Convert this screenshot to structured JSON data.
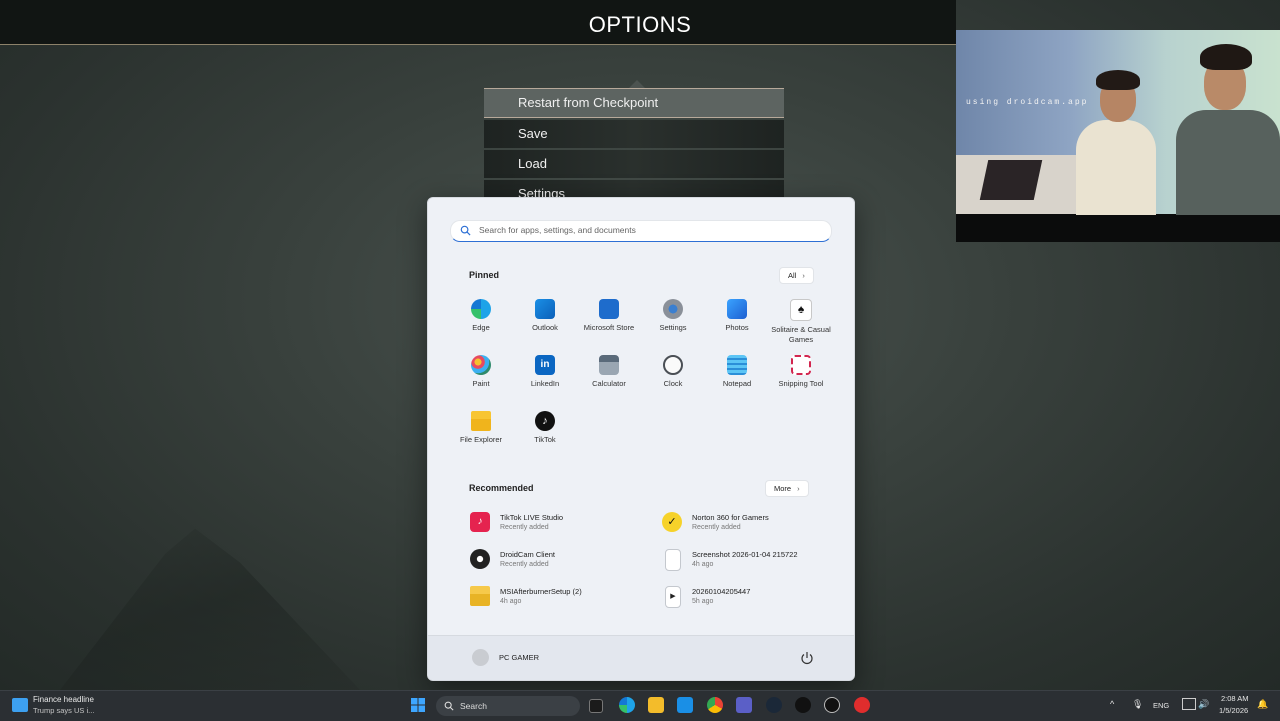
{
  "game": {
    "title": "OPTIONS",
    "menu": [
      "Restart from Checkpoint",
      "Save",
      "Load",
      "Settings"
    ]
  },
  "webcam": {
    "watermark": "using droidcam.app"
  },
  "start_menu": {
    "search_placeholder": "Search for apps, settings, and documents",
    "pinned_label": "Pinned",
    "all_label": "All",
    "pinned": [
      {
        "label": "Edge",
        "icon": "edge-icon"
      },
      {
        "label": "Outlook",
        "icon": "outlook-icon"
      },
      {
        "label": "Microsoft Store",
        "icon": "store-icon"
      },
      {
        "label": "Settings",
        "icon": "settings-gear-icon"
      },
      {
        "label": "Photos",
        "icon": "photos-icon"
      },
      {
        "label": "Solitaire & Casual Games",
        "icon": "solitaire-icon"
      },
      {
        "label": "Paint",
        "icon": "paint-icon"
      },
      {
        "label": "LinkedIn",
        "icon": "linkedin-icon"
      },
      {
        "label": "Calculator",
        "icon": "calculator-icon"
      },
      {
        "label": "Clock",
        "icon": "clock-icon"
      },
      {
        "label": "Notepad",
        "icon": "notepad-icon"
      },
      {
        "label": "Snipping Tool",
        "icon": "snipping-tool-icon"
      },
      {
        "label": "File Explorer",
        "icon": "folder-icon"
      },
      {
        "label": "TikTok",
        "icon": "tiktok-icon"
      }
    ],
    "recommended_label": "Recommended",
    "more_label": "More",
    "recommended": [
      {
        "name": "TikTok LIVE Studio",
        "sub": "Recently added",
        "icon": "tiktok-live-icon"
      },
      {
        "name": "Norton 360 for Gamers",
        "sub": "Recently added",
        "icon": "norton-icon"
      },
      {
        "name": "DroidCam Client",
        "sub": "Recently added",
        "icon": "droidcam-icon"
      },
      {
        "name": "Screenshot 2026-01-04 215722",
        "sub": "4h ago",
        "icon": "image-file-icon"
      },
      {
        "name": "MSIAfterburnerSetup (2)",
        "sub": "4h ago",
        "icon": "zip-folder-icon"
      },
      {
        "name": "20260104205447",
        "sub": "5h ago",
        "icon": "video-file-icon"
      }
    ],
    "user": "PC GAMER"
  },
  "taskbar": {
    "widget_title": "Finance headline",
    "widget_sub": "Trump says US i...",
    "search_label": "Search",
    "lang": "ENG",
    "time": "2:08 AM",
    "date": "1/5/2026"
  },
  "colors": {
    "accent": "#2d6fd4",
    "start_bg": "#eef1f6",
    "taskbar_bg": "#2b2f33"
  }
}
